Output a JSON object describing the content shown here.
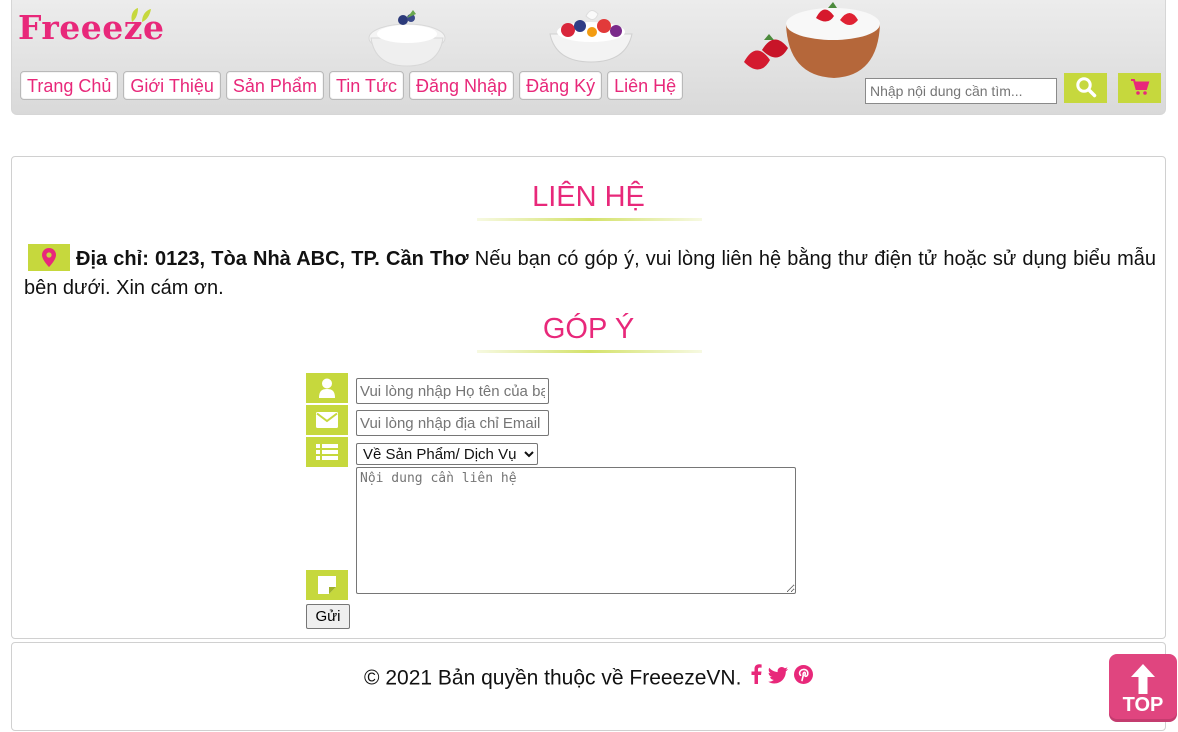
{
  "brand": {
    "logo_text": "Freeeze",
    "primary_color": "#e8287a",
    "accent_color": "#c6d83d"
  },
  "nav": {
    "items": [
      {
        "label": "Trang Chủ"
      },
      {
        "label": "Giới Thiệu"
      },
      {
        "label": "Sản Phẩm"
      },
      {
        "label": "Tin Tức"
      },
      {
        "label": "Đăng Nhập"
      },
      {
        "label": "Đăng Ký"
      },
      {
        "label": "Liên Hệ"
      }
    ]
  },
  "search": {
    "placeholder": "Nhập nội dung cần tìm...",
    "button_icon": "search-icon",
    "cart_icon": "cart-icon"
  },
  "contact": {
    "title": "LIÊN HỆ",
    "address_icon": "map-marker-icon",
    "address_bold": "Địa chỉ: 0123, Tòa Nhà ABC, TP. Cần Thơ",
    "address_text": " Nếu bạn có góp ý, vui lòng liên hệ bằng thư điện tử hoặc sử dụng biểu mẫu bên dưới. Xin cám ơn."
  },
  "feedback": {
    "title": "GÓP Ý",
    "name_placeholder": "Vui lòng nhập Họ tên của bạn",
    "email_placeholder": "Vui lòng nhập địa chỉ Email",
    "topic_selected": "Về Sản Phẩm/ Dịch Vụ",
    "message_placeholder": "Nội dung cần liên hệ",
    "submit_label": "Gửi"
  },
  "footer": {
    "copyright": "© 2021 Bản quyền thuộc về FreeezeVN."
  },
  "back_to_top": {
    "label": "TOP"
  }
}
